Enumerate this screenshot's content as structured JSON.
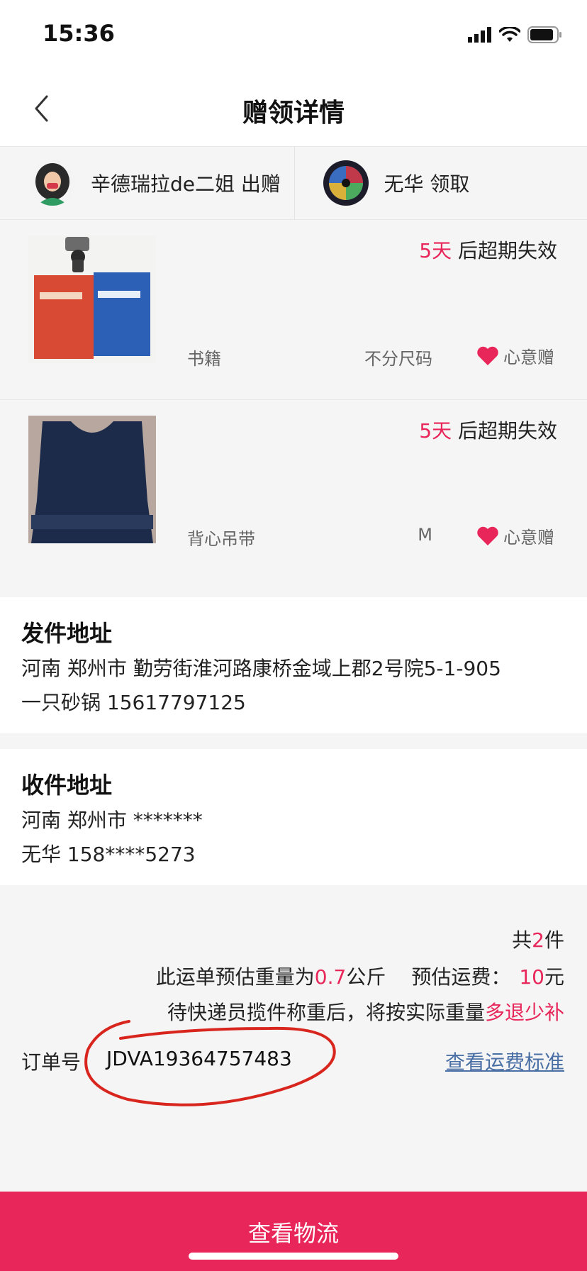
{
  "status_bar": {
    "time": "15:36"
  },
  "nav": {
    "title": "赠领详情"
  },
  "parties": {
    "giver": "辛德瑞拉de二姐 出赠",
    "receiver": "无华 领取"
  },
  "items": [
    {
      "expire_days": "5天",
      "expire_suffix": " 后超期失效",
      "name": "书籍",
      "size": "不分尺码",
      "tag": "心意赠"
    },
    {
      "expire_days": "5天",
      "expire_suffix": " 后超期失效",
      "name": "背心吊带",
      "size": "M",
      "tag": "心意赠"
    }
  ],
  "send_address": {
    "title": "发件地址",
    "line1": "河南 郑州市 勤劳街淮河路康桥金域上郡2号院5-1-905",
    "line2": "一只砂锅 15617797125"
  },
  "receive_address": {
    "title": "收件地址",
    "line1": "河南 郑州市 *******",
    "line2": "无华 158****5273"
  },
  "summary": {
    "count_prefix": "共",
    "count": "2",
    "count_suffix": "件",
    "weight_prefix": "此运单预估重量为",
    "weight": "0.7",
    "weight_suffix": "公斤",
    "fee_prefix": "预估运费：",
    "fee": "10",
    "fee_suffix": "元",
    "note_prefix": "待快递员揽件称重后，将按实际重量",
    "note_highlight": "多退少补",
    "order_label": "订单号",
    "order_no": "JDVA19364757483",
    "fee_link": "查看运费标准"
  },
  "bottom_button": "查看物流",
  "colors": {
    "accent": "#e8265a",
    "link": "#4a6fa5",
    "annotation": "#d8261e"
  }
}
